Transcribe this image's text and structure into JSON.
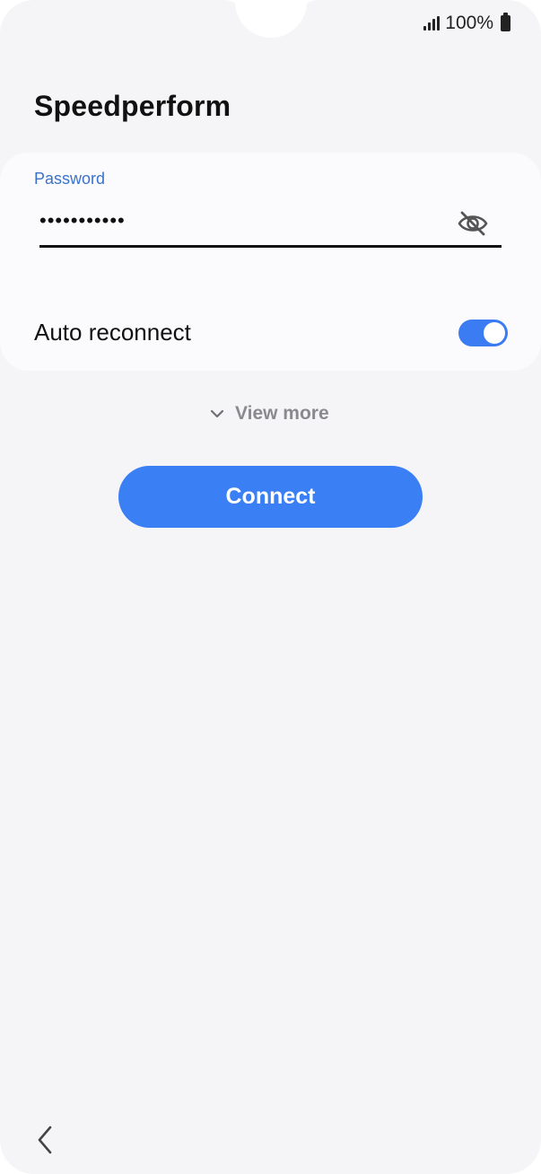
{
  "status_bar": {
    "battery_text": "100%",
    "icons": [
      "signal-icon",
      "battery-icon"
    ]
  },
  "header": {
    "title": "Speedperform"
  },
  "password": {
    "label": "Password",
    "value": "•••••••••••",
    "visibility_icon": "eye-off-icon"
  },
  "auto_reconnect": {
    "label": "Auto reconnect",
    "enabled": true
  },
  "view_more": {
    "label": "View more",
    "icon": "chevron-down-icon"
  },
  "connect_button": {
    "label": "Connect"
  },
  "nav": {
    "back_icon": "back-chevron-icon"
  },
  "colors": {
    "accent": "#3a7ff4",
    "label_blue": "#3a72c9",
    "background": "#f5f5f7",
    "card": "#fbfbfd"
  }
}
